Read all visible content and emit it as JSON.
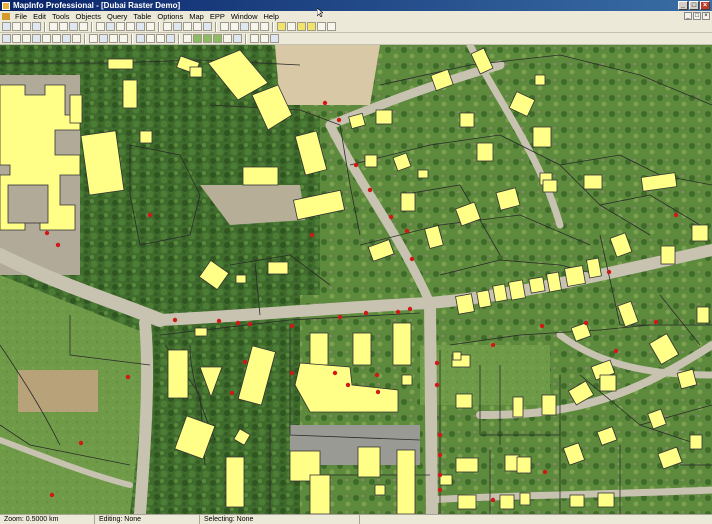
{
  "window": {
    "title": "MapInfo Professional - [Dubai Raster Demo]"
  },
  "menu": {
    "items": [
      "File",
      "Edit",
      "Tools",
      "Objects",
      "Query",
      "Table",
      "Options",
      "Map",
      "EPP",
      "Window",
      "Help"
    ]
  },
  "statusbar": {
    "zoom": "Zoom: 0.5000 km",
    "editing": "Editing: None",
    "selecting": "Selecting: None"
  },
  "colors": {
    "building_fill": "#ffff88",
    "parcel_line": "#2b2b2b",
    "survey_point": "#d01818",
    "title_gradient_start": "#0a246a",
    "title_gradient_end": "#3a6ea5"
  },
  "icons": {
    "toolbar_row1": [
      "new-icon",
      "open-icon",
      "save-icon",
      "print-icon",
      "cut-icon",
      "copy-icon",
      "paste-icon",
      "undo-icon",
      "new-browser-icon",
      "new-mapper-icon",
      "new-grapher-icon",
      "new-layout-icon",
      "new-redistrict-icon",
      "help-icon",
      "select-icon",
      "marquee-icon",
      "radius-icon",
      "polygon-select-icon",
      "boundary-select-icon",
      "zoom-in-icon",
      "zoom-out-icon",
      "change-view-icon",
      "grabber-icon",
      "info-icon",
      "label-icon",
      "drag-window-icon",
      "hotlink-icon",
      "legend-icon",
      "statistics-icon",
      "ruler-icon"
    ],
    "toolbar_row2": [
      "symbol-icon",
      "line-icon",
      "polyline-icon",
      "arc-icon",
      "polygon-icon",
      "ellipse-icon",
      "rectangle-icon",
      "rounded-rect-icon",
      "text-icon",
      "frame-icon",
      "reshape-icon",
      "add-node-icon",
      "symbol-style-icon",
      "line-style-icon",
      "region-style-icon",
      "text-style-icon",
      "layer-control-icon",
      "tree-icon",
      "tree-alt-icon",
      "park-icon",
      "house-icon",
      "road-icon",
      "node-icon",
      "snap-icon",
      "digitize-icon"
    ]
  }
}
